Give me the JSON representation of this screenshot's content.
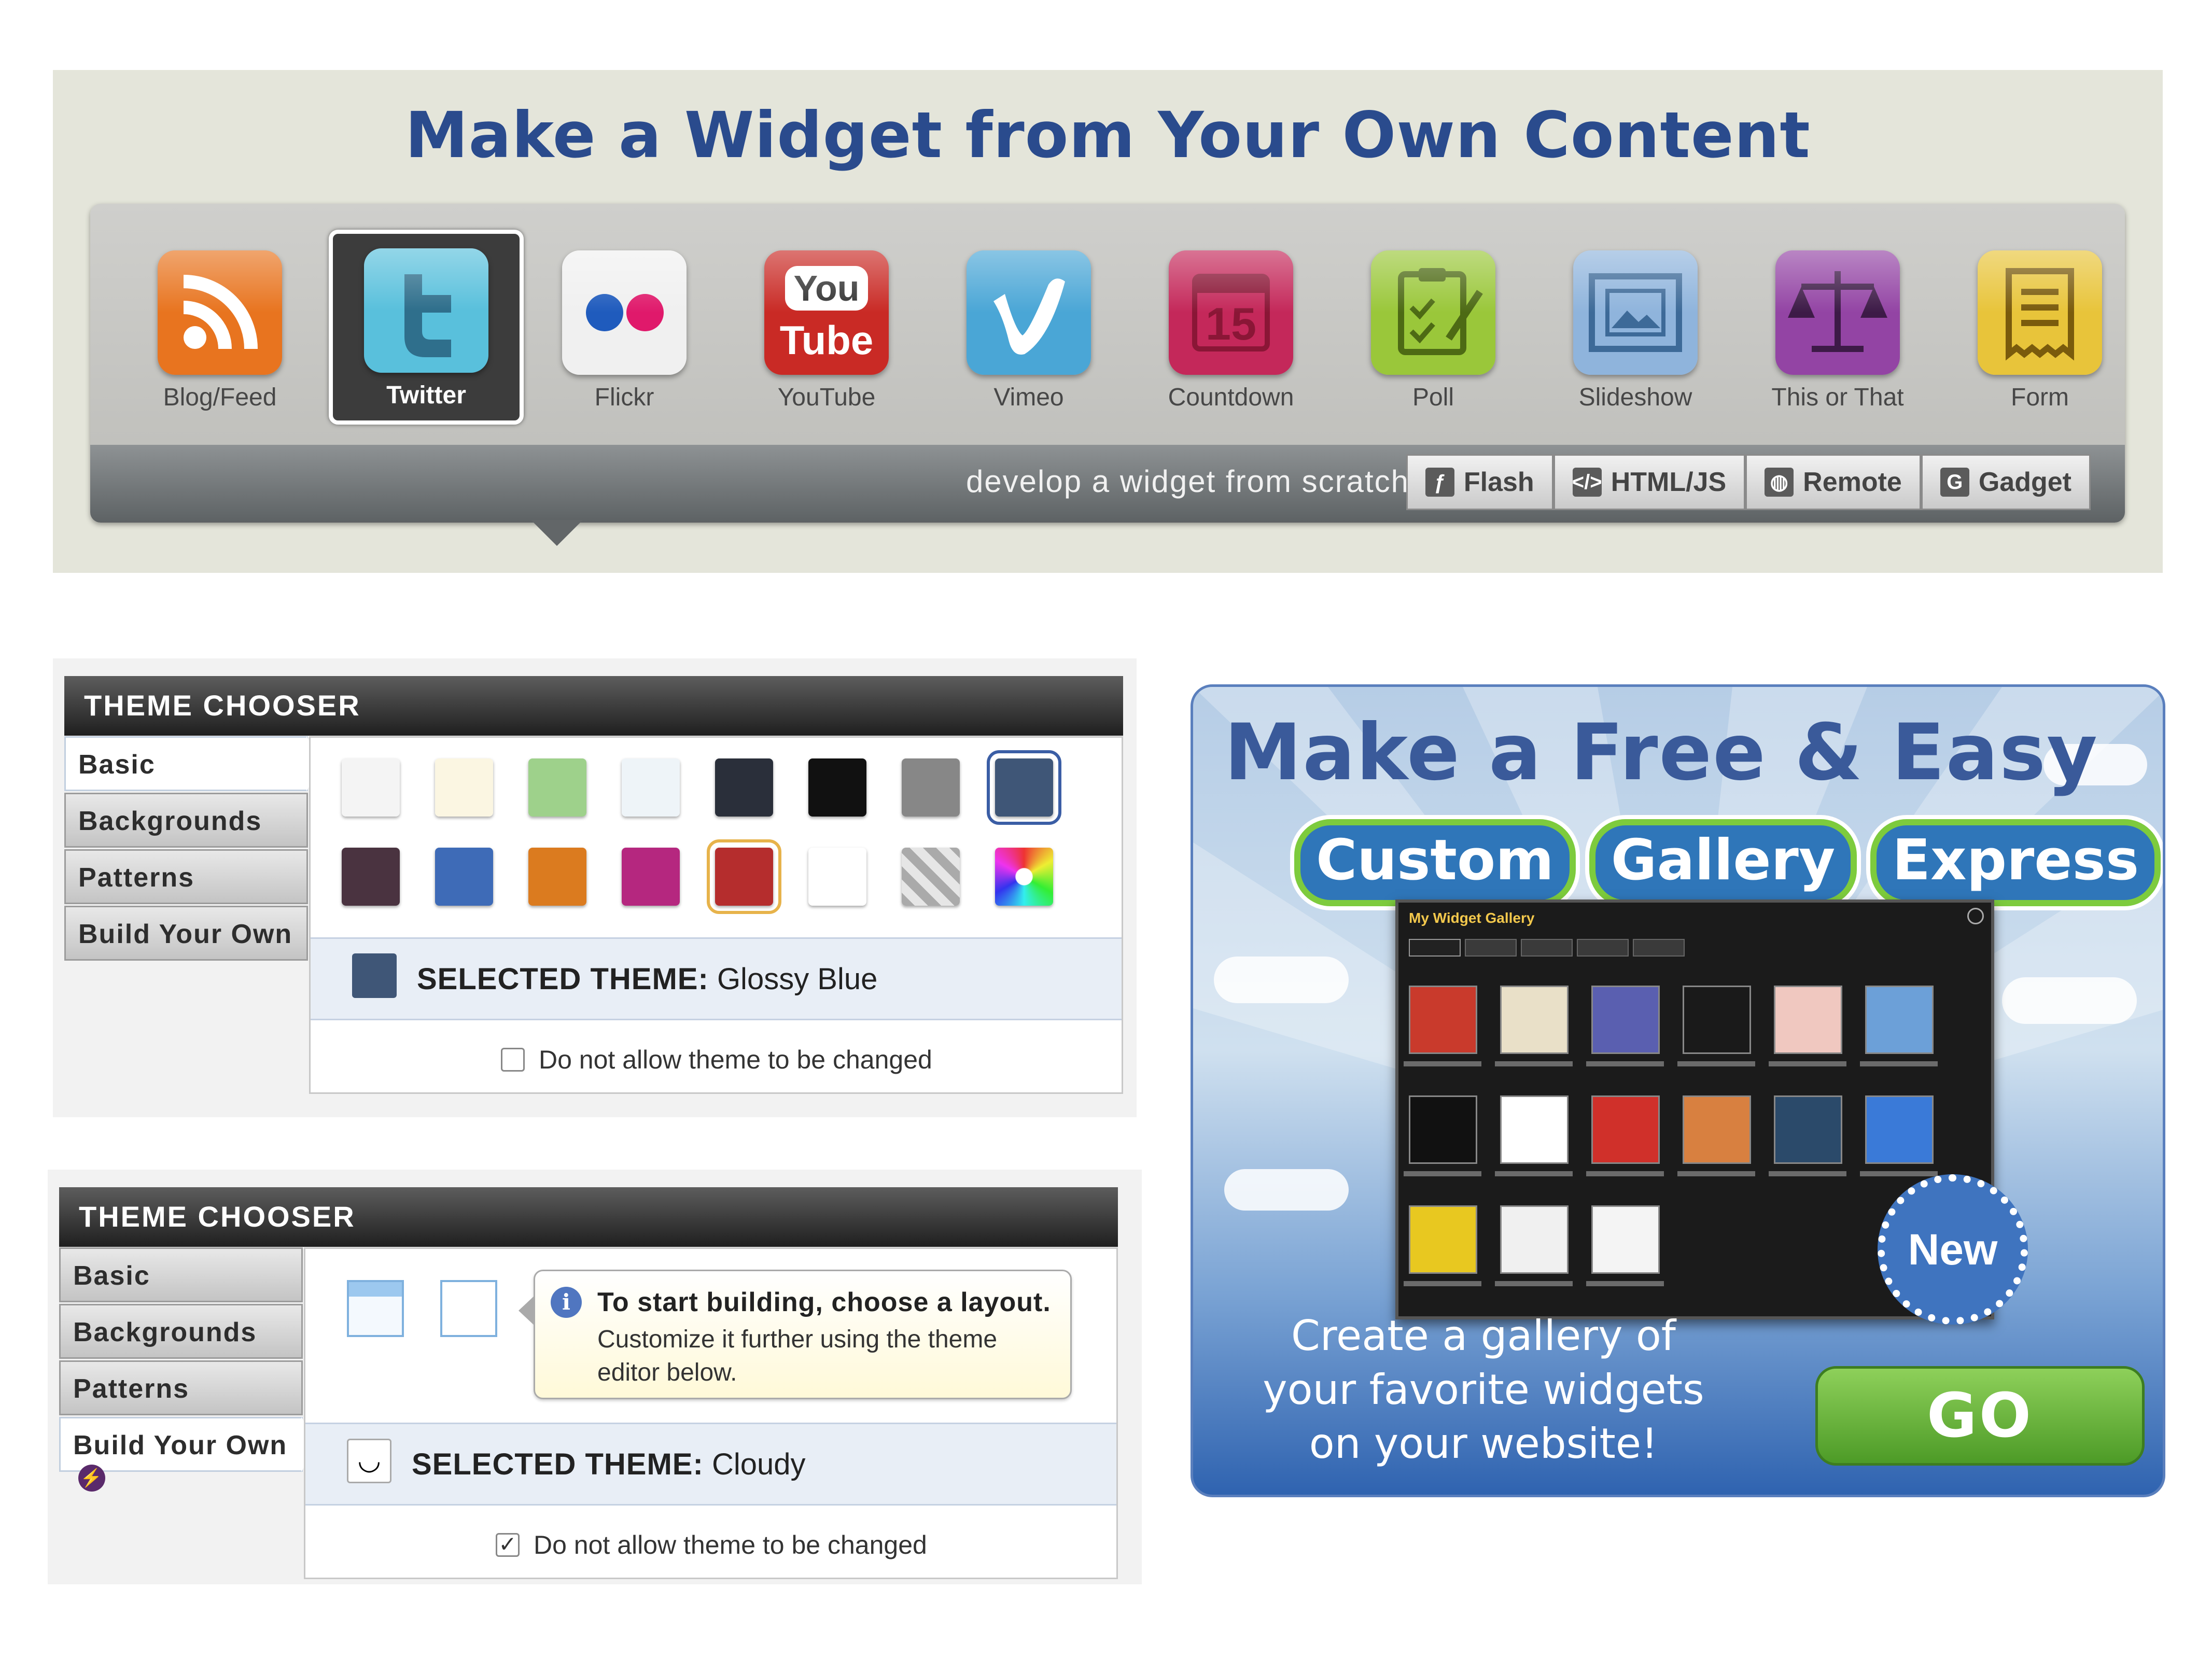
{
  "top": {
    "title": "Make a Widget from Your Own Content",
    "widgets": [
      {
        "label": "Blog/Feed",
        "icon": "rss-icon",
        "color": "#e8741f"
      },
      {
        "label": "Twitter",
        "icon": "twitter-icon",
        "color": "#59c0dc",
        "selected": true
      },
      {
        "label": "Flickr",
        "icon": "flickr-icon",
        "color": "#f0f0f0"
      },
      {
        "label": "YouTube",
        "icon": "youtube-icon",
        "color": "#c92a25"
      },
      {
        "label": "Vimeo",
        "icon": "vimeo-icon",
        "color": "#4aa6d6"
      },
      {
        "label": "Countdown",
        "icon": "calendar-icon",
        "color": "#c4285a"
      },
      {
        "label": "Poll",
        "icon": "clipboard-check-icon",
        "color": "#9ac73a"
      },
      {
        "label": "Slideshow",
        "icon": "slideshow-icon",
        "color": "#8fb4dc"
      },
      {
        "label": "This or That",
        "icon": "scales-icon",
        "color": "#9344a4"
      },
      {
        "label": "Form",
        "icon": "form-icon",
        "color": "#e8c43a"
      }
    ],
    "youtube_text": {
      "you": "You",
      "tube": "Tube"
    },
    "countdown_number": "15",
    "scratch": {
      "text": "develop a widget from scratch",
      "buttons": [
        {
          "label": "Flash",
          "icon": "flash-icon",
          "glyph": "ƒ"
        },
        {
          "label": "HTML/JS",
          "icon": "code-icon",
          "glyph": "</>"
        },
        {
          "label": "Remote",
          "icon": "globe-icon",
          "glyph": "◍"
        },
        {
          "label": "Gadget",
          "icon": "google-icon",
          "glyph": "G"
        }
      ]
    }
  },
  "theme_chooser_1": {
    "header": "THEME CHOOSER",
    "tabs": [
      "Basic",
      "Backgrounds",
      "Patterns",
      "Build Your Own"
    ],
    "active_tab": "Basic",
    "swatch_colors_row1": [
      "#f4f4f4",
      "#fbf6e2",
      "#9ed18b",
      "#eef4f8",
      "#2a2f3a",
      "#111111",
      "#878787",
      "#3f5677"
    ],
    "swatch_colors_row2": [
      "#4a3340",
      "#3e6bb7",
      "#db7b1f",
      "#b5277f",
      "#b52d2d",
      "#b88a35",
      "#c8c8c8",
      "#ffffff"
    ],
    "selected_label": "SELECTED THEME:",
    "selected_value": "Glossy Blue",
    "selected_color": "#3f5677",
    "lock_label": "Do not allow theme to be changed",
    "lock_checked": false
  },
  "theme_chooser_2": {
    "header": "THEME CHOOSER",
    "tabs": [
      "Basic",
      "Backgrounds",
      "Patterns",
      "Build Your Own"
    ],
    "active_tab": "Build Your Own",
    "tooltip_title": "To start building, choose a layout.",
    "tooltip_body": "Customize it further using the theme editor below.",
    "selected_label": "SELECTED THEME:",
    "selected_value": "Cloudy",
    "lock_label": "Do not allow theme to be changed",
    "lock_checked": true
  },
  "promo": {
    "title": "Make a Free & Easy",
    "sub": [
      "Custom",
      "Gallery",
      "Express"
    ],
    "gallery_title": "My Widget Gallery",
    "badge": "New",
    "body": "Create a gallery of your favorite widgets on your website!",
    "go": "GO",
    "thumb_colors": [
      "#c93a2c",
      "#e9e0c8",
      "#5a5fb0",
      "#1a1a1a",
      "#f0c8c0",
      "#6ca0d8",
      "#111111",
      "#ffffff",
      "#d0302a",
      "#d88040",
      "#2b4a6a",
      "#3a7ad8",
      "#e8c820",
      "#f0f0f0",
      "#f4f4f4"
    ]
  }
}
